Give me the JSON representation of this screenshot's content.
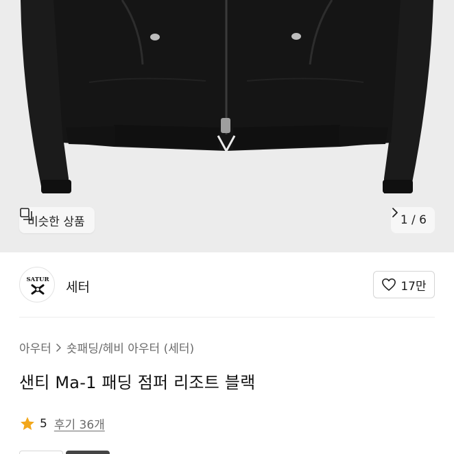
{
  "gallery": {
    "product_image": "black-padded-jacket-photo",
    "similar_button": {
      "icon": "similar-items-icon",
      "label": "비슷한 상품"
    },
    "pager": {
      "label": "1 / 6",
      "icon": "chevron-right-icon"
    }
  },
  "brand": {
    "logo_text": "SATUR",
    "name": "세터",
    "like_icon": "heart-outline-icon",
    "like_count": "17만"
  },
  "breadcrumb": {
    "items": [
      "아우터",
      "숏패딩/헤비 아우터 (세터)"
    ],
    "separator_icon": "chevron-right-icon"
  },
  "product": {
    "title": "샌티 Ma-1 패딩 점퍼 리조트 블랙"
  },
  "rating": {
    "star_icon": "star-icon",
    "score": "5",
    "reviews_label": "후기 36개"
  },
  "colors": {
    "gallery_bg": "#ececec",
    "star": "#f2a71b",
    "text_secondary": "#6b6b6b"
  }
}
